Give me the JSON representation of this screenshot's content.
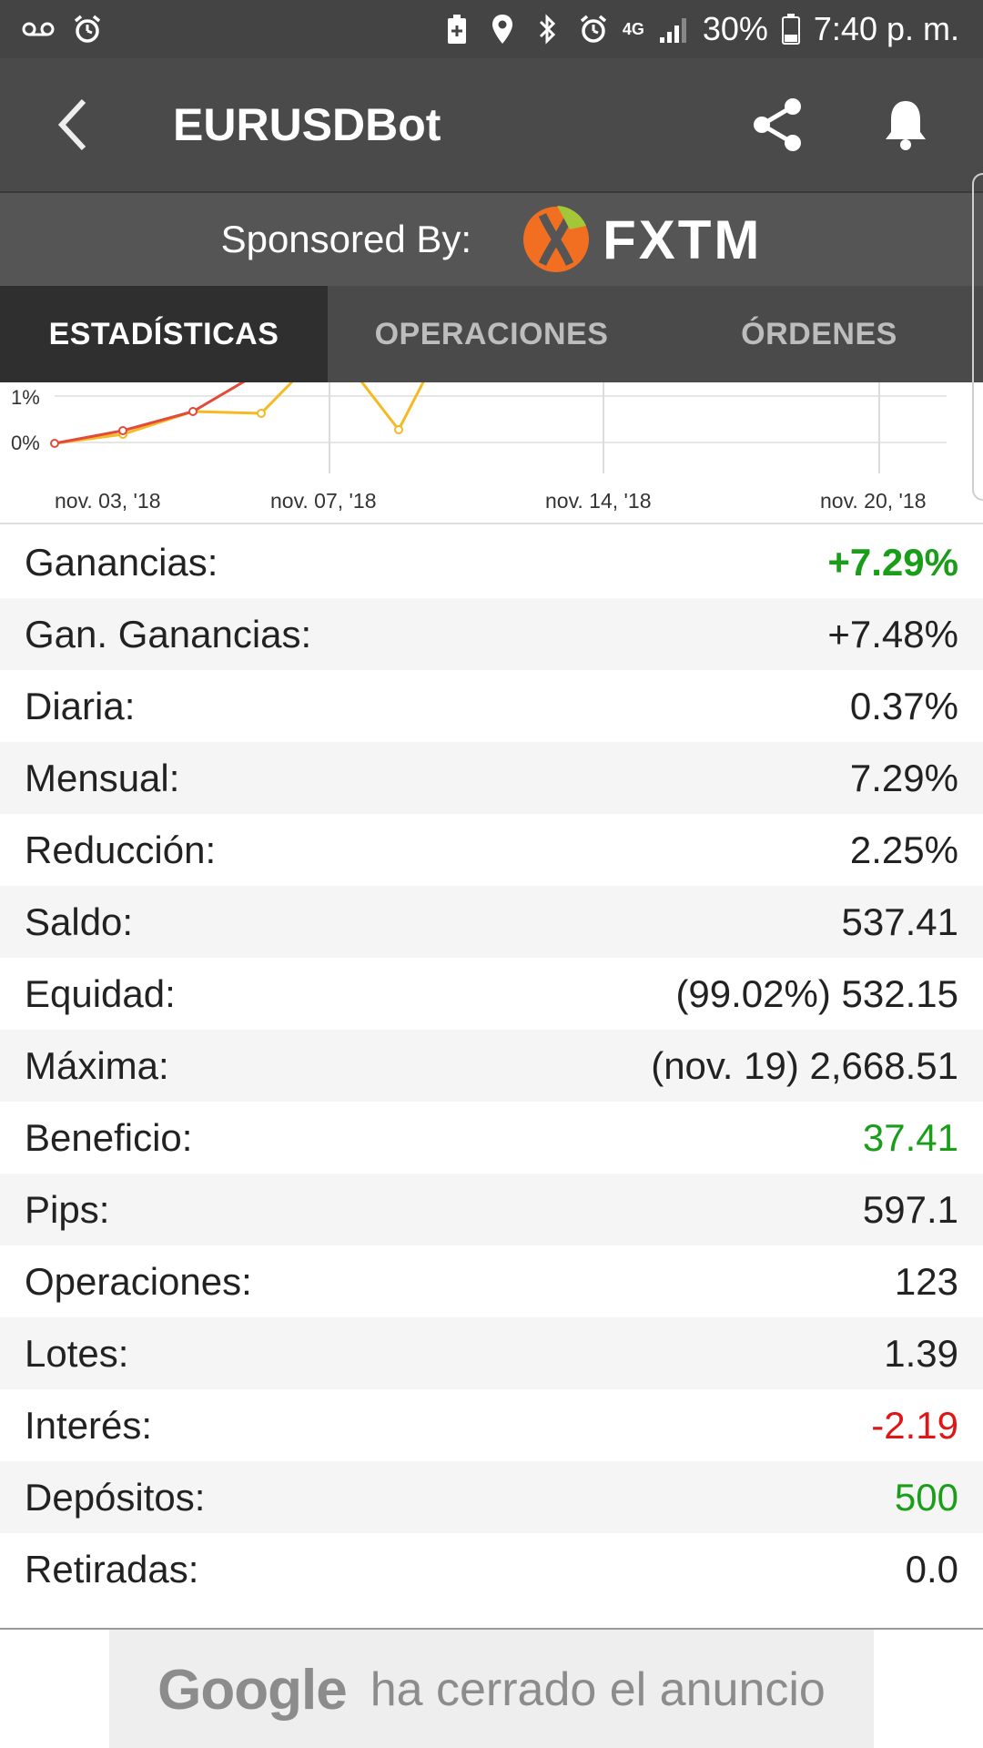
{
  "status_bar": {
    "battery": "30%",
    "time": "7:40 p. m.",
    "network": "4G"
  },
  "app_bar": {
    "title": "EURUSDBot"
  },
  "sponsor": {
    "label": "Sponsored By:",
    "brand": "FXTM",
    "brand_color": "#f26f21",
    "brand_accent": "#a4c639"
  },
  "tabs": [
    {
      "label": "ESTADÍSTICAS",
      "active": true
    },
    {
      "label": "OPERACIONES",
      "active": false
    },
    {
      "label": "ÓRDENES",
      "active": false
    }
  ],
  "chart_data": {
    "type": "line",
    "x_ticks": [
      "nov. 03, '18",
      "nov. 07, '18",
      "nov. 14, '18",
      "nov. 20, '18"
    ],
    "y_ticks": [
      "1%",
      "0%"
    ],
    "series": [
      {
        "color": "#f5b921",
        "points": [
          [
            "nov. 03",
            0.0
          ],
          [
            "nov. 04",
            0.2
          ],
          [
            "nov. 05",
            0.7
          ],
          [
            "nov. 06",
            0.65
          ],
          [
            "nov. 08",
            0.3
          ]
        ]
      },
      {
        "color": "#e24b3b",
        "points": [
          [
            "nov. 03",
            0.0
          ],
          [
            "nov. 04",
            0.25
          ],
          [
            "nov. 05",
            0.7
          ]
        ]
      }
    ]
  },
  "stats": [
    {
      "label": "Ganancias:",
      "value": "+7.29%",
      "color": "green",
      "bold": true
    },
    {
      "label": "Gan. Ganancias:",
      "value": "+7.48%"
    },
    {
      "label": "Diaria:",
      "value": "0.37%"
    },
    {
      "label": "Mensual:",
      "value": "7.29%"
    },
    {
      "label": "Reducción:",
      "value": "2.25%"
    },
    {
      "label": "Saldo:",
      "value": "537.41"
    },
    {
      "label": "Equidad:",
      "value": "(99.02%) 532.15"
    },
    {
      "label": "Máxima:",
      "value": "(nov. 19) 2,668.51"
    },
    {
      "label": "Beneficio:",
      "value": "37.41",
      "color": "green"
    },
    {
      "label": "Pips:",
      "value": "597.1"
    },
    {
      "label": "Operaciones:",
      "value": "123"
    },
    {
      "label": "Lotes:",
      "value": "1.39"
    },
    {
      "label": "Interés:",
      "value": "-2.19",
      "color": "red"
    },
    {
      "label": "Depósitos:",
      "value": "500",
      "color": "green"
    },
    {
      "label": "Retiradas:",
      "value": "0.0"
    }
  ],
  "ad": {
    "brand": "Google",
    "message": "ha cerrado el anuncio"
  }
}
